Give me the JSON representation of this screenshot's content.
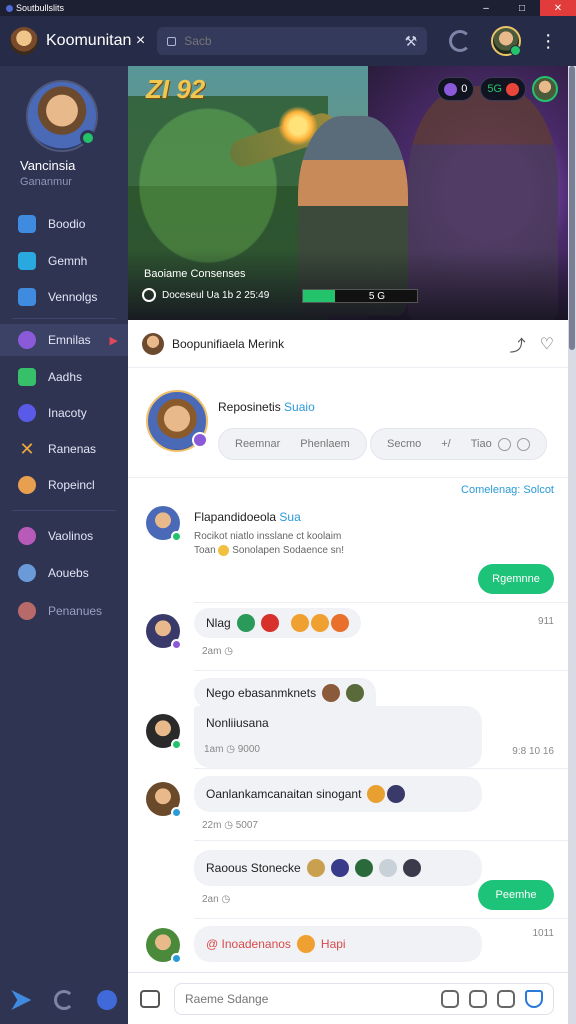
{
  "window": {
    "title": "Soutbullslits",
    "controls": [
      "–",
      "□",
      "✕"
    ]
  },
  "topbar": {
    "brand": "Koomunitan ×",
    "search": {
      "value": "",
      "placeholder": "Sacb"
    },
    "icons": [
      "lock-icon",
      "tool-icon",
      "refresh-icon",
      "kebab-menu-icon"
    ]
  },
  "sidebar": {
    "profile": {
      "name": "Vancinsia",
      "subtitle": "Gananmur"
    },
    "items": [
      {
        "label": "Boodio",
        "icon": "chat-icon",
        "color": "#3f8be0"
      },
      {
        "label": "Gemnh",
        "icon": "monitor-icon",
        "color": "#2aa8e0"
      },
      {
        "label": "Vennolgs",
        "icon": "mail-icon",
        "color": "#3f8be0"
      },
      {
        "label": "Emnilas",
        "icon": "avatar-icon",
        "color": "#8a5ad8"
      },
      {
        "label": "Aadhs",
        "icon": "image-icon",
        "color": "#36c06a"
      },
      {
        "label": "Inacoty",
        "icon": "globe-icon",
        "color": "#5a5ae8"
      },
      {
        "label": "Ranenas",
        "icon": "cross-swords-icon",
        "color": "#f0a83a"
      },
      {
        "label": "Ropeincl",
        "icon": "avatar-icon",
        "color": "#e8a050"
      },
      {
        "label": "Vaolinos",
        "icon": "avatar-icon",
        "color": "#b85ab8"
      },
      {
        "label": "Aouebs",
        "icon": "avatar-icon",
        "color": "#6a9ad8"
      },
      {
        "label": "Penanues",
        "icon": "avatar-icon",
        "color": "#b86a6a"
      }
    ],
    "active_index": 3,
    "active_arrow": "▶"
  },
  "hero": {
    "score": "ZI 92",
    "pills": [
      {
        "text": "0",
        "ball": "#8a5ad8"
      },
      {
        "text": "5G",
        "ball": "#e8463a"
      }
    ],
    "caption_title": "Baoiame Consenses",
    "caption_sub": "Doceseul Ua 1b 2 25:49",
    "bar_value": "5 G",
    "bar_fill_fraction": 0.28
  },
  "panel": {
    "header_title": "Boopunifiaela Merink",
    "feature": {
      "name": "Reposinetis",
      "tag": "Suaio",
      "chip_left": [
        "Reemnar",
        "Phenlaem"
      ],
      "chip_right": [
        "Secmo",
        "+/",
        "Tiao"
      ]
    },
    "filter": "Comelenag: Solcot",
    "messages": [
      {
        "name": "Flapandidoeola",
        "tag": "Sua",
        "line1": "Rocikot niatlo insslane ct koolaim",
        "line2": "Toan",
        "line2b": "Sonolapen Sodaence sn!",
        "button": "Rgemnne"
      },
      {
        "text": "Nlag",
        "time": "2am",
        "rtime": "911"
      },
      {
        "text": "Nego ebasanmknets",
        "text2": "Nonliiusana",
        "time": "1am",
        "time_extra": "9000",
        "rtime": "9:8 10 16"
      },
      {
        "text": "Oanlankamcanaitan sinogant",
        "time": "22m",
        "time_extra": "5007"
      },
      {
        "text": "Raoous Stonecke",
        "time": "2an",
        "button": "Peemhe"
      },
      {
        "text": "@ Inoadenanos",
        "text_b": "Hapi",
        "rtime": "1011"
      }
    ],
    "input": {
      "placeholder": "Raeme Sdange"
    }
  }
}
